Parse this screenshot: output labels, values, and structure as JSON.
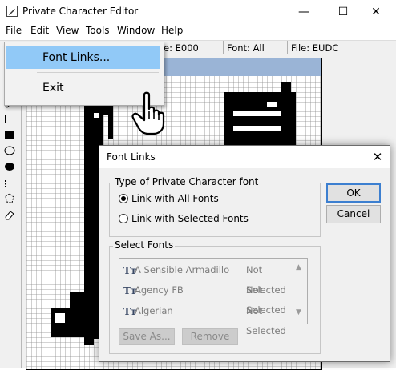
{
  "window": {
    "title": "Private Character Editor",
    "minimize_glyph": "—",
    "maximize_glyph": "☐",
    "close_glyph": "✕"
  },
  "menu": {
    "file": "File",
    "edit": "Edit",
    "view": "View",
    "tools": "Tools",
    "window": "Window",
    "help": "Help"
  },
  "status": {
    "char_code": "e: E000",
    "font": "Font: All",
    "file": "File: EUDC"
  },
  "dropdown": {
    "items": [
      {
        "label": "Font Links...",
        "highlighted": true
      },
      {
        "label": "Exit",
        "highlighted": false
      }
    ]
  },
  "dialog": {
    "title": "Font Links",
    "close_glyph": "✕",
    "type_group": {
      "label": "Type of Private Character font",
      "options": [
        {
          "label": "Link with All Fonts",
          "selected": true
        },
        {
          "label": "Link with Selected Fonts",
          "selected": false
        }
      ]
    },
    "select_group": {
      "label": "Select Fonts",
      "fonts": [
        {
          "name": "A Sensible Armadillo",
          "status": "Not Selected"
        },
        {
          "name": "Agency FB",
          "status": "Not Selected"
        },
        {
          "name": "Algerian",
          "status": "Not Selected"
        }
      ],
      "save_as_label": "Save As...",
      "remove_label": "Remove"
    },
    "ok_label": "OK",
    "cancel_label": "Cancel"
  },
  "icons": {
    "font_glyph": "Tт",
    "scroll_up": "▲",
    "scroll_down": "▼"
  }
}
